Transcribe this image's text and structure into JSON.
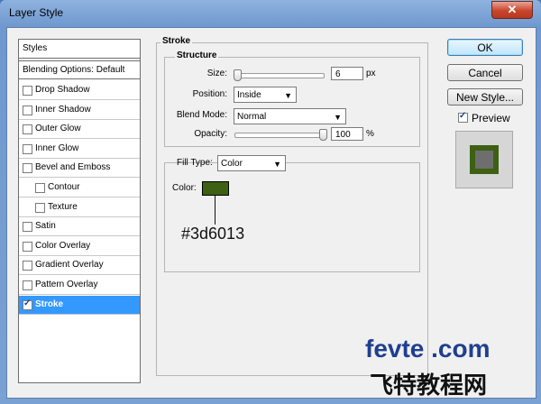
{
  "window": {
    "title": "Layer Style",
    "close_glyph": "✕"
  },
  "styles_panel": {
    "header": "Styles",
    "blending": "Blending Options: Default",
    "items": [
      {
        "label": "Drop Shadow",
        "checked": false
      },
      {
        "label": "Inner Shadow",
        "checked": false
      },
      {
        "label": "Outer Glow",
        "checked": false
      },
      {
        "label": "Inner Glow",
        "checked": false
      },
      {
        "label": "Bevel and Emboss",
        "checked": false
      },
      {
        "label": "Contour",
        "checked": false
      },
      {
        "label": "Texture",
        "checked": false
      },
      {
        "label": "Satin",
        "checked": false
      },
      {
        "label": "Color Overlay",
        "checked": false
      },
      {
        "label": "Gradient Overlay",
        "checked": false
      },
      {
        "label": "Pattern Overlay",
        "checked": false
      },
      {
        "label": "Stroke",
        "checked": true
      }
    ]
  },
  "stroke": {
    "title": "Stroke",
    "structure": {
      "title": "Structure",
      "size_label": "Size:",
      "size_value": "6",
      "size_unit": "px",
      "size_fraction": 0.02,
      "position_label": "Position:",
      "position_value": "Inside",
      "blend_label": "Blend Mode:",
      "blend_value": "Normal",
      "opacity_label": "Opacity:",
      "opacity_value": "100",
      "opacity_unit": "%",
      "opacity_fraction": 1.0
    },
    "fill": {
      "type_label": "Fill Type:",
      "type_value": "Color",
      "color_label": "Color:",
      "color": "#3d6013",
      "annotation": "#3d6013"
    }
  },
  "buttons": {
    "ok": "OK",
    "cancel": "Cancel",
    "new_style": "New Style..."
  },
  "preview": {
    "label": "Preview",
    "checked": true,
    "stroke_color": "#3d6013",
    "fill_color": "#6e6e6e"
  },
  "watermark": {
    "line1": "fevte .com",
    "line2": "飞特教程网"
  }
}
